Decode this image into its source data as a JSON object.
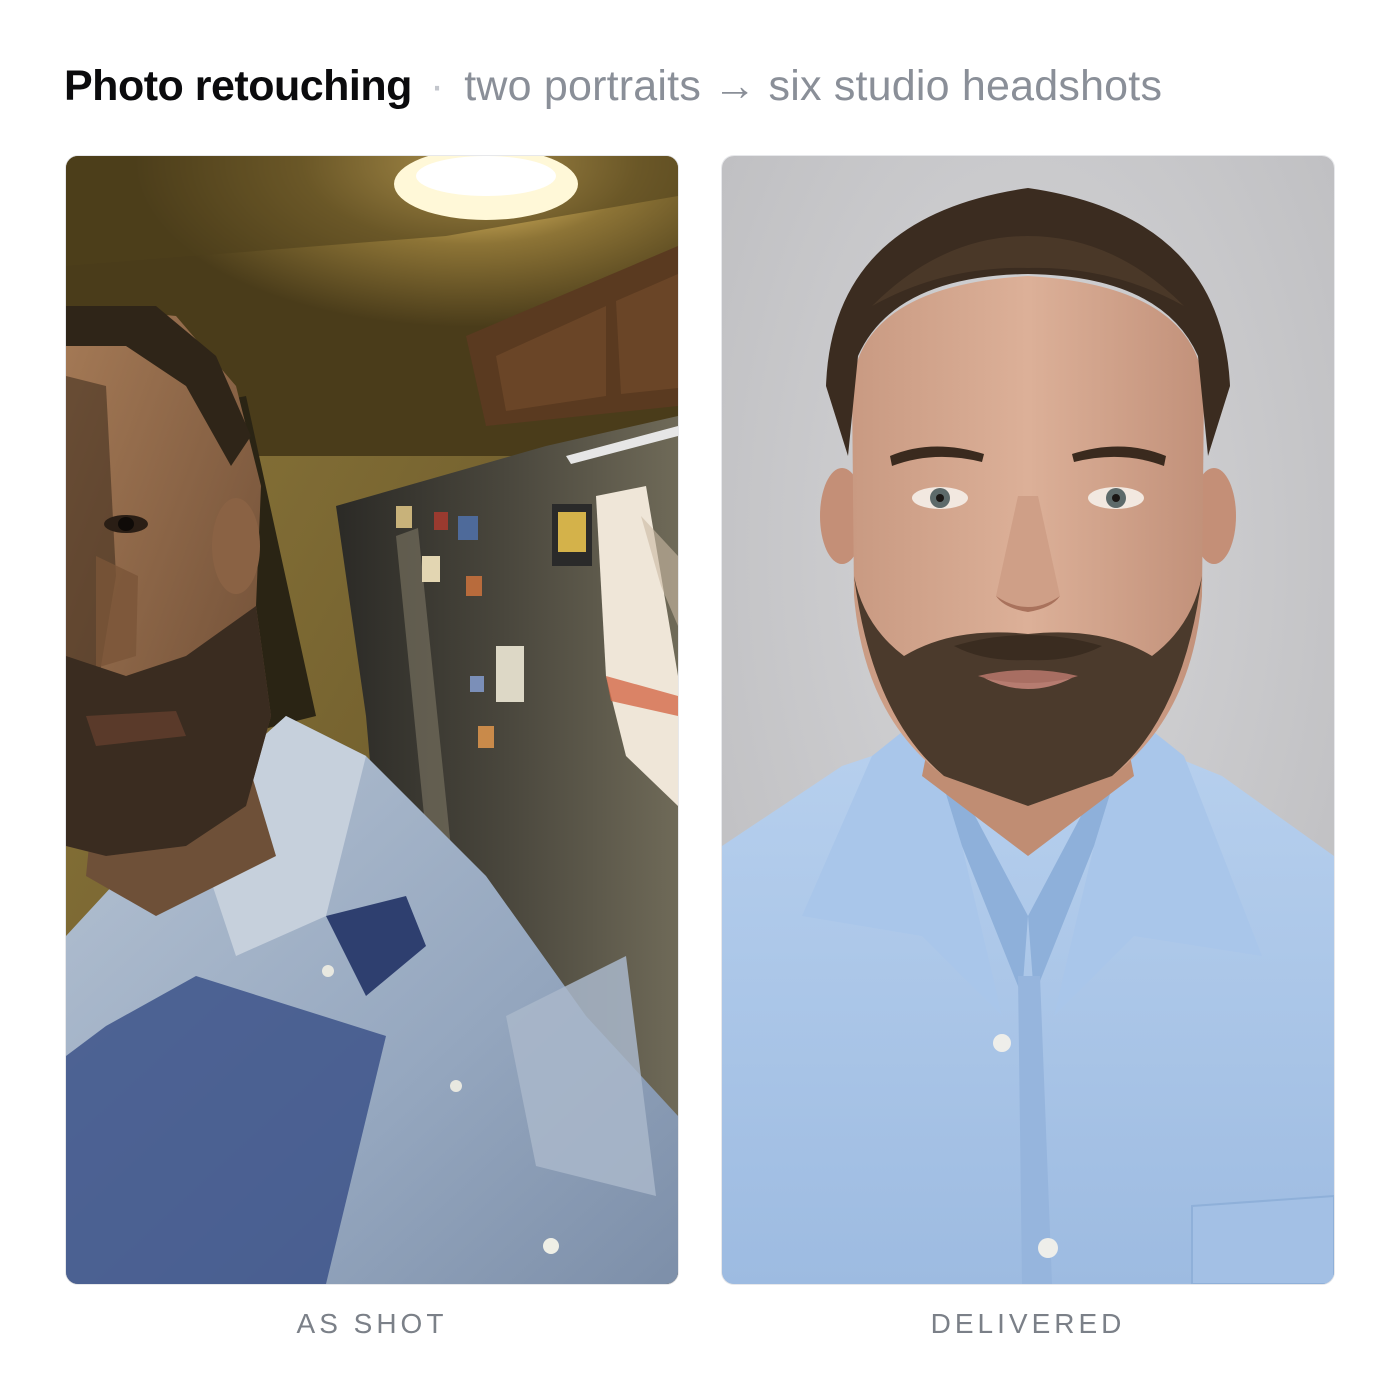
{
  "header": {
    "title": "Photo retouching",
    "separator": "·",
    "subtitle": "two portraits → six studio headshots"
  },
  "panels": [
    {
      "caption": "AS SHOT"
    },
    {
      "caption": "DELIVERED"
    }
  ],
  "colors": {
    "title": "#0b0b0d",
    "subtitle": "#8a8f98",
    "caption": "#7b8088",
    "studio_background": "#c9c9cc",
    "shirt_blue": "#a8c4e6",
    "kitchen_warm": "#7a6530"
  }
}
